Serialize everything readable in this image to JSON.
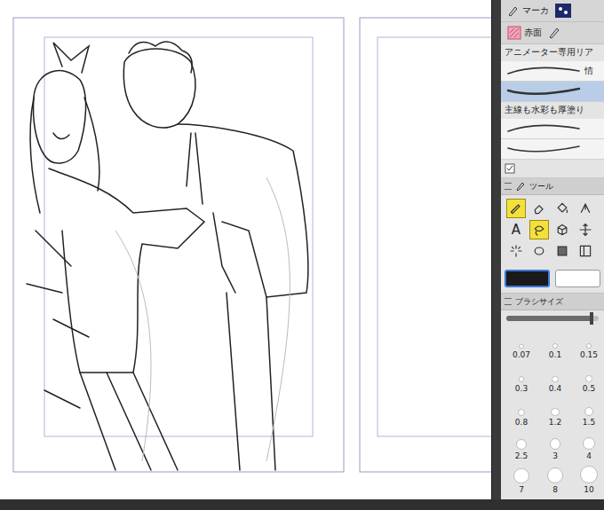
{
  "subtool_tabs": [
    {
      "label": "マーカ",
      "selected": false
    },
    {
      "label": "赤面",
      "selected": false
    }
  ],
  "brush_groups": [
    {
      "title": "アニメーター専用リア",
      "strokes": [
        {
          "label": "情",
          "selected": false
        },
        {
          "label": "",
          "selected": true
        }
      ]
    },
    {
      "title": "主線も水彩も厚塗り",
      "strokes": [
        {
          "label": "",
          "selected": false
        },
        {
          "label": "",
          "selected": false
        }
      ]
    }
  ],
  "tool_panel": {
    "title": "ツール",
    "tools": [
      {
        "label": "",
        "selected": true
      },
      {
        "label": "",
        "selected": false
      },
      {
        "label": "",
        "selected": false
      },
      {
        "label": "",
        "selected": false
      },
      {
        "label": "A",
        "selected": false
      },
      {
        "label": "",
        "selected": true
      },
      {
        "label": "",
        "selected": false
      },
      {
        "label": "",
        "selected": false
      },
      {
        "label": "",
        "selected": false
      },
      {
        "label": "",
        "selected": false
      },
      {
        "label": "",
        "selected": false
      },
      {
        "label": "",
        "selected": false
      }
    ]
  },
  "colors": [
    {
      "color": "#1a1a1a",
      "selected": true
    },
    {
      "color": "#ffffff",
      "selected": false
    }
  ],
  "brush_size": {
    "title": "ブラシサイズ",
    "level": 0.92,
    "sizes": [
      {
        "label": "0.07",
        "selected": false
      },
      {
        "label": "0.1",
        "selected": false
      },
      {
        "label": "0.15",
        "selected": false
      },
      {
        "label": "0.3",
        "selected": false
      },
      {
        "label": "0.4",
        "selected": false
      },
      {
        "label": "0.5",
        "selected": false
      },
      {
        "label": "0.8",
        "selected": false
      },
      {
        "label": "1.2",
        "selected": false
      },
      {
        "label": "1.5",
        "selected": false
      },
      {
        "label": "2.5",
        "selected": false
      },
      {
        "label": "3",
        "selected": false
      },
      {
        "label": "4",
        "selected": false
      },
      {
        "label": "7",
        "selected": false
      },
      {
        "label": "8",
        "selected": false
      },
      {
        "label": "10",
        "selected": false
      }
    ]
  }
}
